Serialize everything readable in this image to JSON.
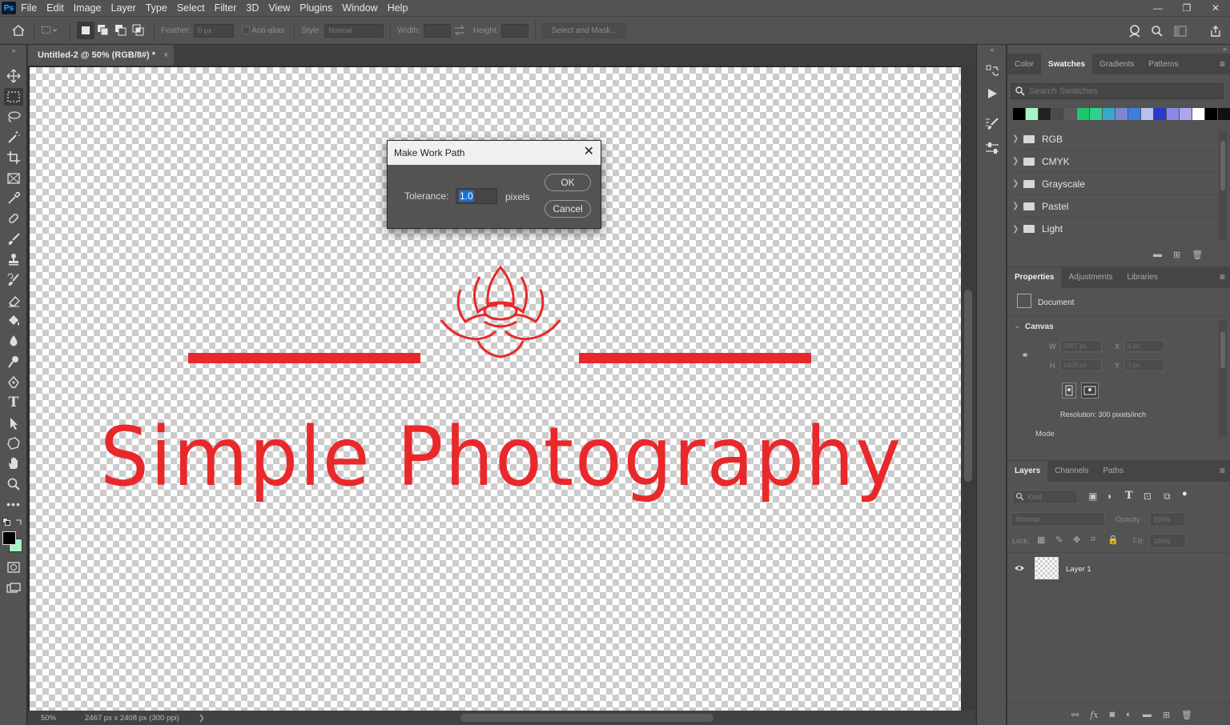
{
  "app": {
    "logo": "Ps"
  },
  "menu": [
    "File",
    "Edit",
    "Image",
    "Layer",
    "Type",
    "Select",
    "Filter",
    "3D",
    "View",
    "Plugins",
    "Window",
    "Help"
  ],
  "window_controls": {
    "minimize": "—",
    "restore": "❐",
    "close": "✕"
  },
  "options": {
    "feather_label": "Feather:",
    "feather_value": "0 px",
    "antialias_label": "Anti-alias",
    "style_label": "Style:",
    "style_value": "Normal",
    "width_label": "Width:",
    "height_label": "Height:",
    "select_mask": "Select and Mask..."
  },
  "document": {
    "tab_title": "Untitled-2 @ 50% (RGB/8#) *",
    "tab_close": "×",
    "logo_text": "Simple Photography",
    "logo_color": "#e8282a"
  },
  "status": {
    "zoom": "50%",
    "info": "2467 px x 2408 px (300 ppi)",
    "arrow": "❯"
  },
  "dialog": {
    "title": "Make Work Path",
    "tolerance_label": "Tolerance:",
    "tolerance_value": "1.0",
    "unit": "pixels",
    "ok": "OK",
    "cancel": "Cancel"
  },
  "swatches_panel": {
    "tabs": [
      "Color",
      "Swatches",
      "Gradients",
      "Patterns"
    ],
    "active_tab": "Swatches",
    "search_placeholder": "Search Swatches",
    "recent_colors": [
      "#000000",
      "#a6f3c6",
      "#222222",
      "#4a4a4a",
      "#5a5a5a",
      "#1ec86a",
      "#2fd08c",
      "#3aa8c8",
      "#7d86d6",
      "#3d7fe0",
      "#b7c2ec",
      "#2b39c9",
      "#8a8ae6",
      "#b0a4ec",
      "#ffffff",
      "#000000",
      "#111111"
    ],
    "folders": [
      "RGB",
      "CMYK",
      "Grayscale",
      "Pastel",
      "Light"
    ]
  },
  "properties_panel": {
    "tabs": [
      "Properties",
      "Adjustments",
      "Libraries"
    ],
    "active_tab": "Properties",
    "document_label": "Document",
    "canvas_label": "Canvas",
    "w_label": "W",
    "w_value": "2467 px",
    "h_label": "H",
    "h_value": "2408 px",
    "x_label": "X",
    "x_value": "0 px",
    "y_label": "Y",
    "y_value": "0 px",
    "resolution": "Resolution: 300 pixels/inch",
    "mode_label": "Mode"
  },
  "layers_panel": {
    "tabs": [
      "Layers",
      "Channels",
      "Paths"
    ],
    "active_tab": "Layers",
    "kind_placeholder": "Kind",
    "blend_mode": "Normal",
    "opacity_label": "Opacity:",
    "opacity_value": "100%",
    "lock_label": "Lock:",
    "fill_label": "Fill:",
    "fill_value": "100%",
    "layers": [
      {
        "name": "Layer 1",
        "visible": true
      }
    ]
  },
  "colors": {
    "foreground": "#000000",
    "background": "#a6f3c6",
    "accent": "#31a8ff"
  }
}
